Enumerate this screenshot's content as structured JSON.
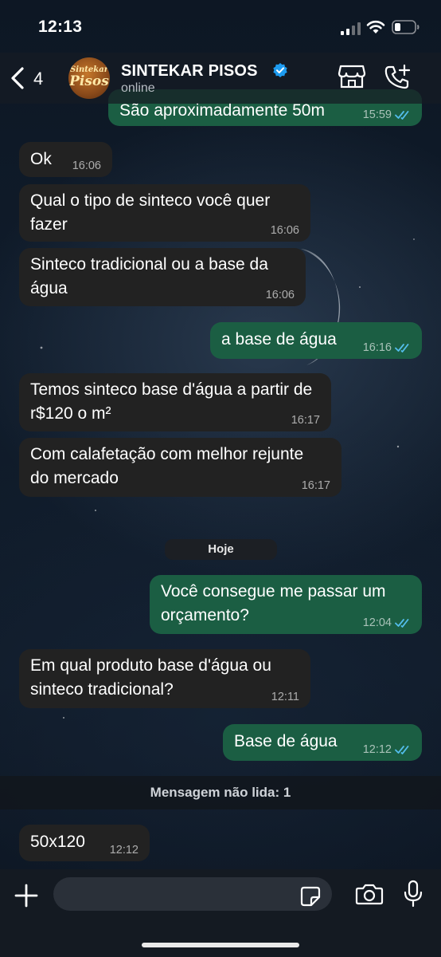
{
  "status_bar": {
    "time": "12:13"
  },
  "header": {
    "back_count": "4",
    "avatar_text_top": "Sintekar",
    "avatar_text_main": "Pisos",
    "contact_name": "SINTEKAR PISOS",
    "presence": "online"
  },
  "messages": [
    {
      "dir": "out",
      "text": "São aproximadamente 50m",
      "time": "15:59",
      "read": true
    },
    {
      "dir": "in",
      "text": "Ok",
      "time": "16:06"
    },
    {
      "dir": "in",
      "text": "Qual o tipo de sinteco você quer fazer",
      "time": "16:06"
    },
    {
      "dir": "in",
      "text": "Sinteco tradicional ou a base da água",
      "time": "16:06"
    },
    {
      "dir": "out",
      "text": "a base de água",
      "time": "16:16",
      "read": true
    },
    {
      "dir": "in",
      "text": "Temos sinteco base d'água a partir de r$120 o m²",
      "time": "16:17"
    },
    {
      "dir": "in",
      "text": "Com calafetação com melhor rejunte do mercado",
      "time": "16:17"
    },
    {
      "dir": "out",
      "text": "Você consegue me passar um orçamento?",
      "time": "12:04",
      "read": true
    },
    {
      "dir": "in",
      "text": "Em qual produto base d'água ou sinteco tradicional?",
      "time": "12:11"
    },
    {
      "dir": "out",
      "text": "Base de água",
      "time": "12:12",
      "read": true
    },
    {
      "dir": "in",
      "text": "50x120",
      "time": "12:12"
    }
  ],
  "date_separator": "Hoje",
  "unread_banner": "Mensagem não lida: 1",
  "composer": {
    "placeholder": ""
  },
  "colors": {
    "incoming_bubble": "#222222",
    "outgoing_bubble": "#1b5e43",
    "read_ticks": "#53bdeb",
    "verified_badge": "#1d9bf0"
  },
  "icons": [
    "back-chevron-icon",
    "verified-badge-icon",
    "store-icon",
    "call-add-icon",
    "plus-icon",
    "sticker-icon",
    "camera-icon",
    "mic-icon",
    "read-ticks-icon",
    "signal-icon",
    "wifi-icon",
    "battery-icon"
  ]
}
